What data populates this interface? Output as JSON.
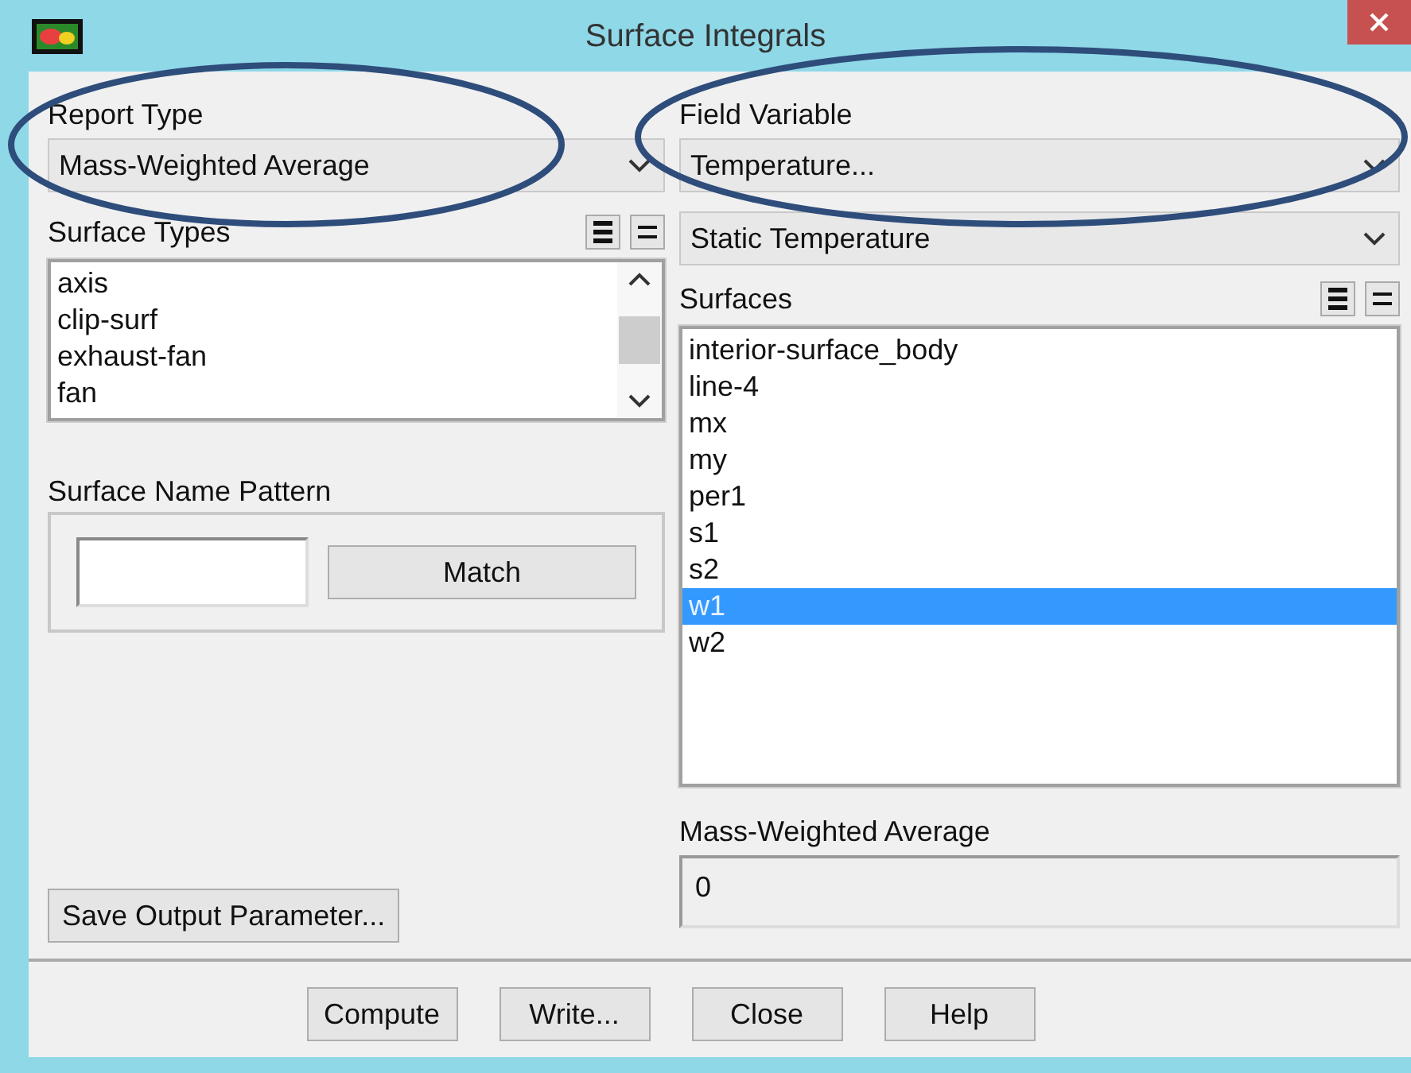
{
  "window": {
    "title": "Surface Integrals"
  },
  "report_type": {
    "label": "Report Type",
    "value": "Mass-Weighted Average"
  },
  "surface_types": {
    "label": "Surface Types",
    "items": [
      {
        "label": "axis",
        "selected": false
      },
      {
        "label": "clip-surf",
        "selected": false
      },
      {
        "label": "exhaust-fan",
        "selected": false
      },
      {
        "label": "fan",
        "selected": false
      }
    ]
  },
  "name_pattern": {
    "label": "Surface Name Pattern",
    "button": "Match"
  },
  "save_button": "Save Output Parameter...",
  "field_variable": {
    "label": "Field Variable",
    "value": "Temperature...",
    "sub_value": "Static Temperature"
  },
  "surfaces": {
    "label": "Surfaces",
    "items": [
      {
        "label": "interior-surface_body",
        "selected": false
      },
      {
        "label": "line-4",
        "selected": false
      },
      {
        "label": "mx",
        "selected": false
      },
      {
        "label": "my",
        "selected": false
      },
      {
        "label": "per1",
        "selected": false
      },
      {
        "label": "s1",
        "selected": false
      },
      {
        "label": "s2",
        "selected": false
      },
      {
        "label": "w1",
        "selected": true
      },
      {
        "label": "w2",
        "selected": false
      }
    ]
  },
  "result": {
    "label": "Mass-Weighted Average",
    "value": "0"
  },
  "buttons": [
    "Compute",
    "Write...",
    "Close",
    "Help"
  ]
}
